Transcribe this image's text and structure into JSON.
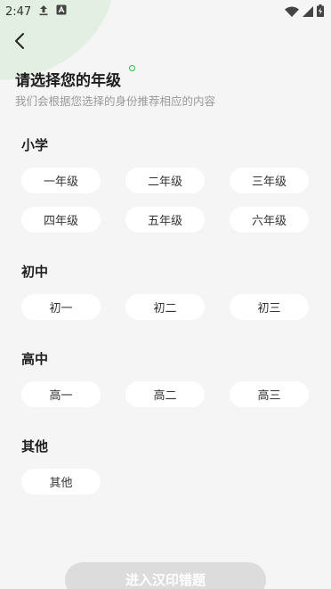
{
  "status_bar": {
    "time": "2:47"
  },
  "header": {
    "title": "请选择您的年级",
    "subtitle": "我们会根据您选择的身份推荐相应的内容"
  },
  "sections": [
    {
      "title": "小学",
      "options": [
        "一年级",
        "二年级",
        "三年级",
        "四年级",
        "五年级",
        "六年级"
      ]
    },
    {
      "title": "初中",
      "options": [
        "初一",
        "初二",
        "初三"
      ]
    },
    {
      "title": "高中",
      "options": [
        "高一",
        "高二",
        "高三"
      ]
    },
    {
      "title": "其他",
      "options": [
        "其他"
      ]
    }
  ],
  "submit_label": "进入汉印错题",
  "colors": {
    "accent": "#33b45a",
    "background": "#f4f5f4",
    "chip_bg": "#ffffff",
    "button_disabled": "#dcdcdc"
  }
}
